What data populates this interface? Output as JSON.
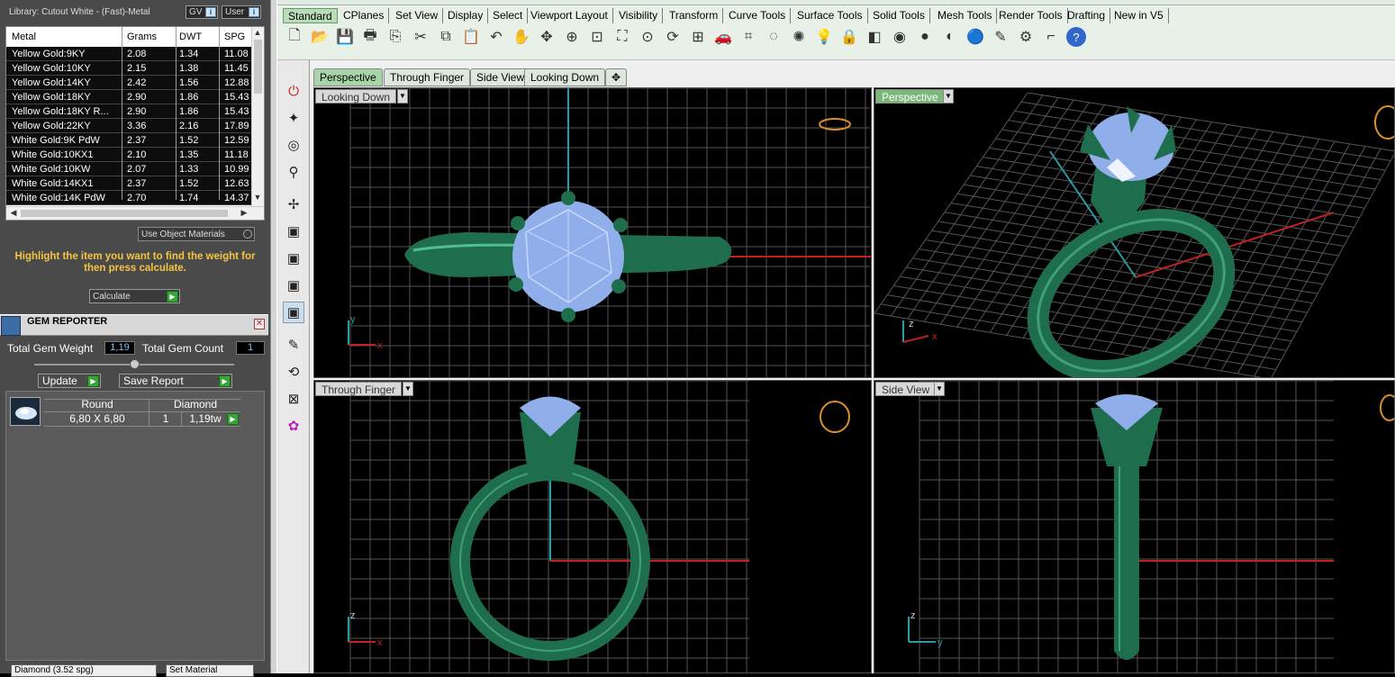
{
  "library": {
    "title": "Library: Cutout White - (Fast)-Metal",
    "gv_label": "GV",
    "user_label": "User",
    "columns": [
      "Metal",
      "Grams",
      "DWT",
      "SPG"
    ],
    "rows": [
      [
        "Yellow Gold:9KY",
        "2.08",
        "1.34",
        "11.08"
      ],
      [
        "Yellow Gold:10KY",
        "2.15",
        "1.38",
        "11.45"
      ],
      [
        "Yellow Gold:14KY",
        "2.42",
        "1.56",
        "12.88"
      ],
      [
        "Yellow Gold:18KY",
        "2.90",
        "1.86",
        "15.43"
      ],
      [
        "Yellow Gold:18KY R...",
        "2.90",
        "1.86",
        "15.43"
      ],
      [
        "Yellow Gold:22KY",
        "3.36",
        "2.16",
        "17.89"
      ],
      [
        "White Gold:9K PdW",
        "2.37",
        "1.52",
        "12.59"
      ],
      [
        "White Gold:10KX1",
        "2.10",
        "1.35",
        "11.18"
      ],
      [
        "White Gold:10KW",
        "2.07",
        "1.33",
        "10.99"
      ],
      [
        "White Gold:14KX1",
        "2.37",
        "1.52",
        "12.63"
      ],
      [
        "White Gold:14K PdW",
        "2.70",
        "1.74",
        "14.37"
      ]
    ],
    "use_object_materials": "Use Object Materials",
    "hint": "Highlight the item you want to find the weight for then press calculate.",
    "calculate_label": "Calculate"
  },
  "gem_reporter": {
    "title": "GEM REPORTER",
    "total_weight_label": "Total Gem Weight",
    "total_weight_value": "1,19",
    "total_count_label": "Total Gem Count",
    "total_count_value": "1",
    "update_label": "Update",
    "save_report_label": "Save Report",
    "list_headers": [
      "Round",
      "Diamond"
    ],
    "list_row": {
      "size": "6,80 X 6,80",
      "count": "1",
      "weight": "1,19tw"
    },
    "material_select": "Diamond    (3.52 spg)",
    "set_material_label": "Set Material"
  },
  "toolbar": {
    "tabs": [
      "Standard",
      "CPlanes",
      "Set View",
      "Display",
      "Select",
      "Viewport Layout",
      "Visibility",
      "Transform",
      "Curve Tools",
      "Surface Tools",
      "Solid Tools",
      "Mesh Tools",
      "Render Tools",
      "Drafting",
      "New in V5"
    ],
    "active_tab": "Standard",
    "icons": [
      "new-file",
      "open-folder",
      "save",
      "print",
      "import",
      "cut",
      "copy",
      "paste",
      "undo",
      "pan-hand",
      "move",
      "zoom-in",
      "zoom-window",
      "zoom-extents",
      "zoom-selected",
      "rotate-view",
      "four-viewports",
      "car",
      "grid-snap",
      "circle",
      "point",
      "light-bulb",
      "lock",
      "layers",
      "color-wheel",
      "render-sphere",
      "material-sphere",
      "blue-sphere",
      "pen",
      "gear",
      "dimension",
      "help"
    ]
  },
  "viewport_tabs": [
    "Perspective",
    "Through Finger",
    "Side View",
    "Looking Down"
  ],
  "viewports": {
    "top_left": {
      "label": "Looking Down"
    },
    "top_right": {
      "label": "Perspective"
    },
    "bottom_left": {
      "label": "Through Finger"
    },
    "bottom_right": {
      "label": "Side View"
    }
  },
  "axes": {
    "x": "x",
    "y": "y",
    "z": "z"
  },
  "colors": {
    "ring": "#1e6e4e",
    "gem": "#8faeea",
    "grid": "#555555",
    "xaxis": "#c02020",
    "yaxis": "#2a9aa6",
    "tab_green": "#a8d5a8"
  }
}
